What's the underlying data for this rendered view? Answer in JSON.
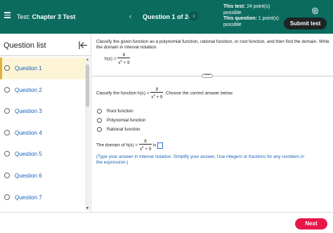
{
  "header": {
    "test_label": "Test:",
    "test_name": "Chapter 3 Test",
    "prev_arrow": "‹",
    "question_counter": "Question 1 of 24",
    "next_arrow": "›",
    "this_test_label": "This test:",
    "this_test_value": "24 point(s) possible",
    "this_question_label": "This question:",
    "this_question_value": "1 point(s) possible",
    "submit_label": "Submit test",
    "accent_color": "#0b6b5f"
  },
  "sidebar": {
    "title": "Question list",
    "items": [
      {
        "label": "Question 1"
      },
      {
        "label": "Question 2"
      },
      {
        "label": "Question 3"
      },
      {
        "label": "Question 4"
      },
      {
        "label": "Question 5"
      },
      {
        "label": "Question 6"
      },
      {
        "label": "Question 7"
      }
    ],
    "active_index": 0,
    "active_color": "#fdf4d6"
  },
  "question": {
    "instruction": "Classify the given function as a polynomial function, rational function, or root function, and then find the domain. Write the domain in interval notation.",
    "fn_lhs": "h(x) =",
    "numerator": "8",
    "denominator": "x",
    "exponent": "2",
    "den_tail": " + 9",
    "dots": "•••••",
    "prompt_pre": "Classify the function h(x) =",
    "prompt_post": ". Choose the correct answer below.",
    "options": [
      {
        "label": "Root function"
      },
      {
        "label": "Polynomial function"
      },
      {
        "label": "Rational function"
      }
    ],
    "domain_pre": "The domain of h(x) =",
    "domain_post": "is",
    "hint": "(Type your answer in interval notation. Simplify your answer. Use integers or fractions for any numbers in the expression.)"
  },
  "footer": {
    "next_label": "Next",
    "next_color": "#e8174a"
  }
}
